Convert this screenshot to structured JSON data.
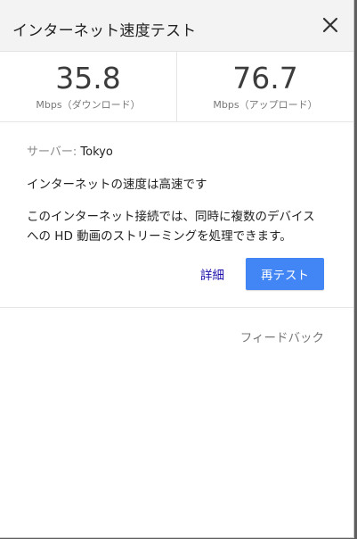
{
  "header": {
    "title": "インターネット速度テスト",
    "close_icon": "close-icon"
  },
  "speeds": {
    "download": {
      "value": "35.8",
      "unit": "Mbps（ダウンロード）"
    },
    "upload": {
      "value": "76.7",
      "unit": "Mbps（アップロード）"
    }
  },
  "info": {
    "server_label": "サーバー: ",
    "server_name": "Tokyo",
    "status": "インターネットの速度は高速です",
    "description_line1": "このインターネット接続では、同時に複数のデバイス",
    "description_line2": "への HD 動画のストリーミングを処理できます。"
  },
  "actions": {
    "details_label": "詳細",
    "retest_label": "再テスト"
  },
  "footer": {
    "feedback_label": "フィードバック"
  },
  "colors": {
    "accent": "#4285f4",
    "link": "#1a0dab",
    "header_bg": "#f3f3f3",
    "backdrop": "#5f5f5f"
  }
}
